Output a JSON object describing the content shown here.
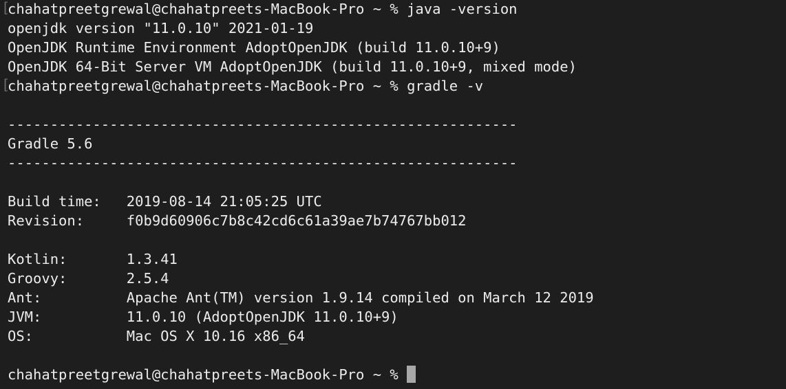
{
  "terminal": {
    "prompt": "chahatpreetgrewal@chahatpreets-MacBook-Pro ~ %",
    "lines": [
      "chahatpreetgrewal@chahatpreets-MacBook-Pro ~ % java -version",
      "openjdk version \"11.0.10\" 2021-01-19",
      "OpenJDK Runtime Environment AdoptOpenJDK (build 11.0.10+9)",
      "OpenJDK 64-Bit Server VM AdoptOpenJDK (build 11.0.10+9, mixed mode)",
      "chahatpreetgrewal@chahatpreets-MacBook-Pro ~ % gradle -v",
      "",
      "------------------------------------------------------------",
      "Gradle 5.6",
      "------------------------------------------------------------",
      "",
      "Build time:   2019-08-14 21:05:25 UTC",
      "Revision:     f0b9d60906c7b8c42cd6c61a39ae7b74767bb012",
      "",
      "Kotlin:       1.3.41",
      "Groovy:       2.5.4",
      "Ant:          Apache Ant(TM) version 1.9.14 compiled on March 12 2019",
      "JVM:          11.0.10 (AdoptOpenJDK 11.0.10+9)",
      "OS:           Mac OS X 10.16 x86_64",
      "",
      "chahatpreetgrewal@chahatpreets-MacBook-Pro ~ %"
    ]
  },
  "colors": {
    "background": "#1e1e1e",
    "text": "#ececec",
    "cursor": "#a8a8a8"
  }
}
